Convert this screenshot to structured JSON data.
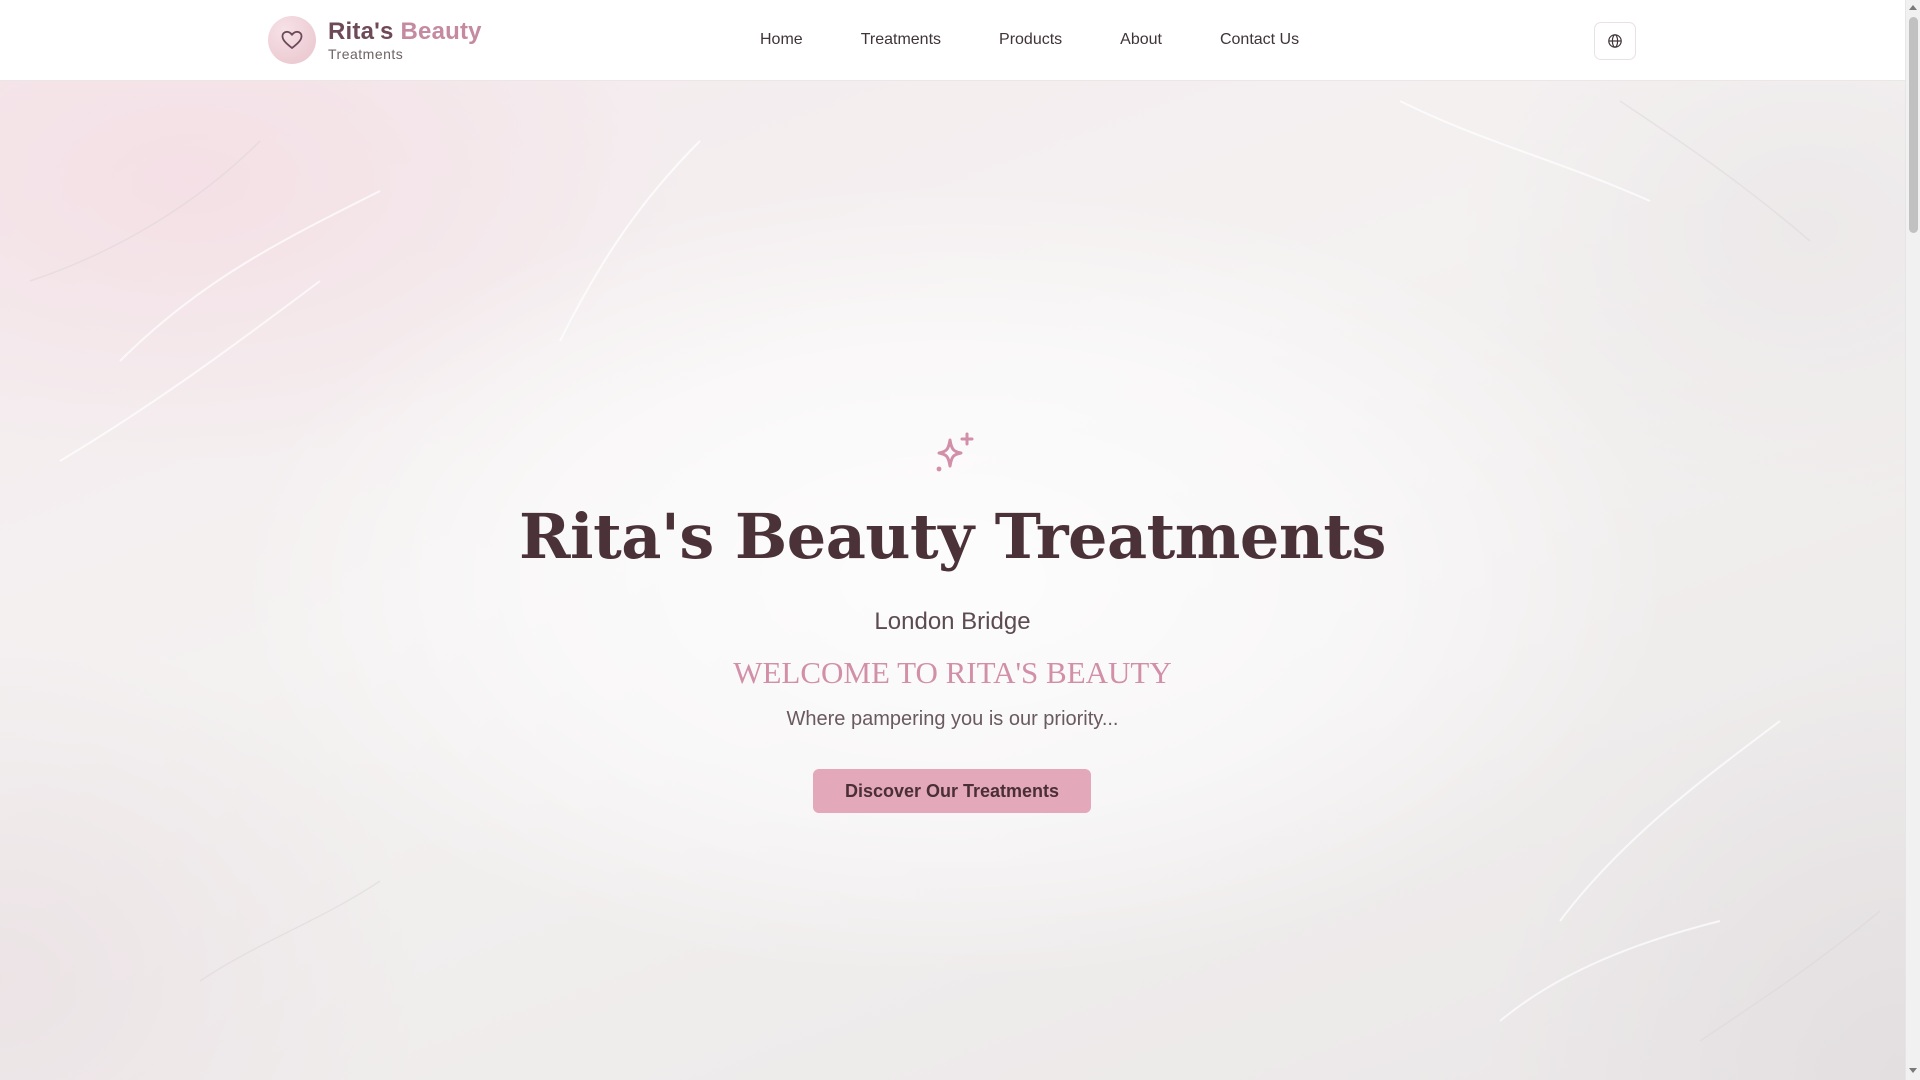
{
  "brand": {
    "title_main": "Rita's",
    "title_accent": "Beauty",
    "subtitle": "Treatments",
    "colors": {
      "accent": "#c58aa0",
      "primary": "#6e4a58",
      "button": "#e4a8bb"
    }
  },
  "nav": {
    "items": [
      {
        "label": "Home"
      },
      {
        "label": "Treatments"
      },
      {
        "label": "Products"
      },
      {
        "label": "About"
      },
      {
        "label": "Contact Us"
      }
    ]
  },
  "header": {
    "language_icon": "globe-icon"
  },
  "hero": {
    "icon": "sparkles-icon",
    "title": "Rita's Beauty Treatments",
    "location": "London Bridge",
    "welcome": "WELCOME TO RITA'S BEAUTY",
    "tagline": "Where pampering you is our priority...",
    "cta_label": "Discover Our Treatments"
  }
}
